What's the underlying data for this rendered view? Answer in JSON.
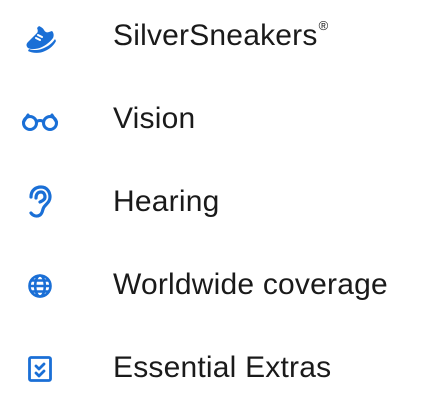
{
  "accent_color": "#1a6fd6",
  "text_color": "#1a1a1a",
  "benefits": [
    {
      "label": "SilverSneakers",
      "suffix": "®",
      "icon": "sneaker-icon"
    },
    {
      "label": "Vision",
      "icon": "eyeglasses-icon"
    },
    {
      "label": "Hearing",
      "icon": "ear-icon"
    },
    {
      "label": "Worldwide coverage",
      "icon": "globe-icon"
    },
    {
      "label": "Essential Extras",
      "icon": "checklist-icon"
    }
  ]
}
